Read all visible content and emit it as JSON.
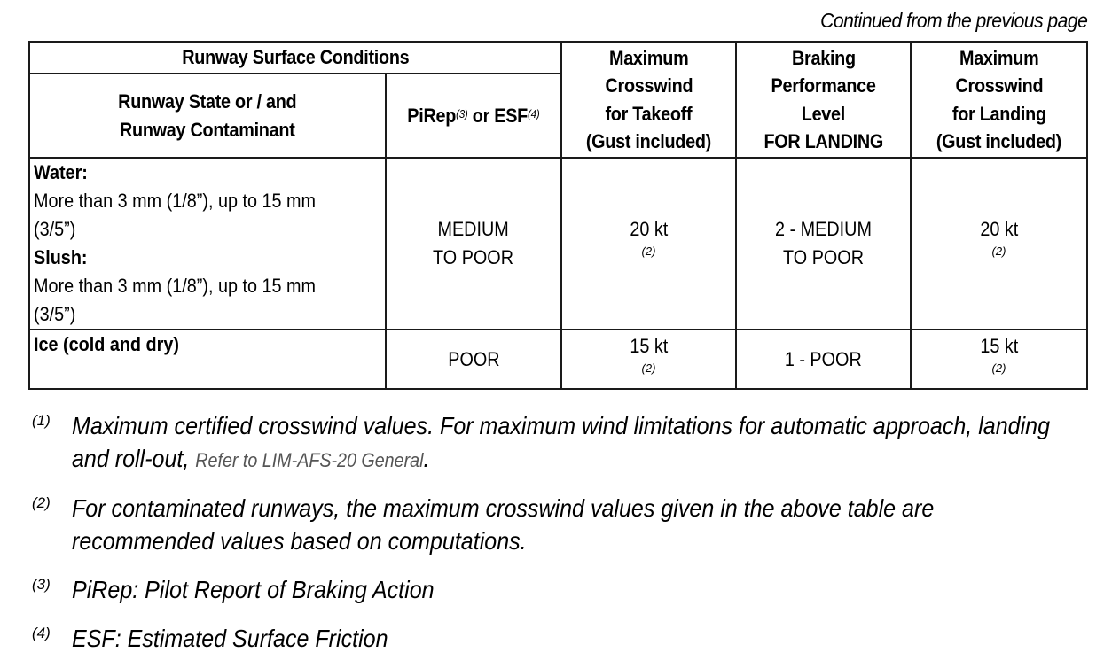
{
  "continued_note": "Continued from the previous page",
  "table": {
    "group_header": "Runway Surface Conditions",
    "headers": {
      "state": [
        "Runway State or / and",
        "Runway Contaminant"
      ],
      "pirep": {
        "label_a": "PiRep",
        "ref_a": "(3)",
        "mid": " or ESF",
        "ref_b": "(4)"
      },
      "takeoff": [
        "Maximum",
        "Crosswind",
        "for Takeoff",
        "(Gust included)"
      ],
      "braking": [
        "Braking",
        "Performance",
        "Level",
        "FOR LANDING"
      ],
      "landing": [
        "Maximum",
        "Crosswind",
        "for Landing",
        "(Gust included)"
      ]
    },
    "rows": [
      {
        "conditions": [
          {
            "title": "Water:",
            "desc": [
              "More than 3 mm (1/8”), up to 15 mm",
              "(3/5”)"
            ]
          },
          {
            "title": "Slush:",
            "desc": [
              "More than 3 mm (1/8”), up to 15 mm",
              "(3/5”)"
            ]
          }
        ],
        "pirep": [
          "MEDIUM",
          "TO POOR"
        ],
        "takeoff": {
          "value": "20 kt",
          "note": "(2)"
        },
        "braking": [
          "2 - MEDIUM",
          "TO POOR"
        ],
        "landing": {
          "value": "20 kt",
          "note": "(2)"
        }
      },
      {
        "conditions": [
          {
            "title": "Ice (cold and dry)"
          }
        ],
        "pirep": [
          "POOR"
        ],
        "takeoff": {
          "value": "15 kt",
          "note": "(2)"
        },
        "braking": [
          "1 - POOR"
        ],
        "landing": {
          "value": "15 kt",
          "note": "(2)"
        }
      }
    ]
  },
  "footnotes": [
    {
      "num": "(1)",
      "lines": [
        "Maximum certified crosswind values. For maximum wind limitations for automatic approach, landing",
        "and roll-out, "
      ],
      "link": "Refer to LIM-AFS-20 General",
      "after_link": "."
    },
    {
      "num": "(2)",
      "lines": [
        "For contaminated runways, the maximum crosswind values given in the above table are",
        "recommended values based on computations."
      ]
    },
    {
      "num": "(3)",
      "lines": [
        "PiRep: Pilot Report of Braking Action"
      ]
    },
    {
      "num": "(4)",
      "lines": [
        "ESF: Estimated Surface Friction"
      ]
    }
  ]
}
